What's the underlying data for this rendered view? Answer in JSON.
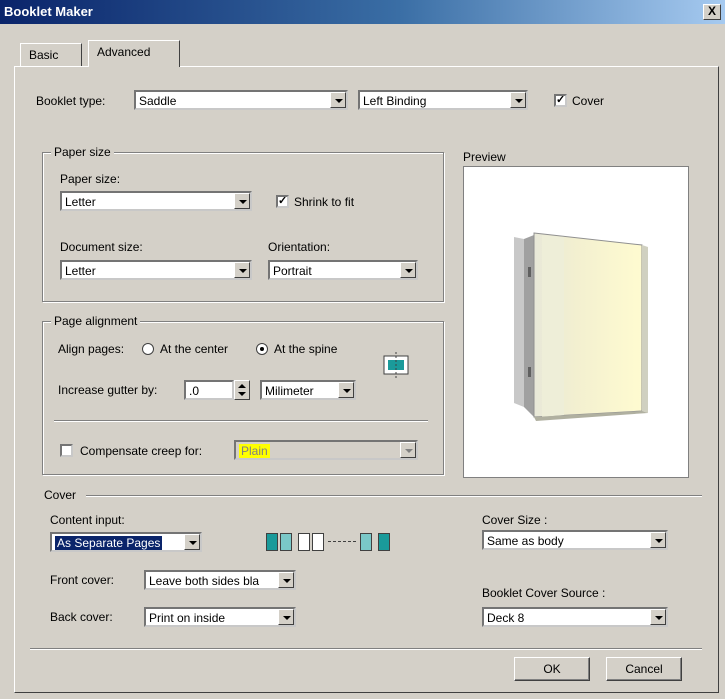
{
  "window": {
    "title": "Booklet Maker",
    "close_glyph": "X"
  },
  "tabs": [
    {
      "label": "Basic"
    },
    {
      "label": "Advanced"
    }
  ],
  "booklet": {
    "type_label": "Booklet type:",
    "type_value": "Saddle",
    "binding_value": "Left Binding",
    "cover_label": "Cover",
    "cover_checked": true
  },
  "paper_size_group": {
    "legend": "Paper size",
    "paper_size_label": "Paper size:",
    "paper_size_value": "Letter",
    "shrink_label": "Shrink to fit",
    "shrink_checked": true,
    "document_size_label": "Document size:",
    "document_size_value": "Letter",
    "orientation_label": "Orientation:",
    "orientation_value": "Portrait"
  },
  "preview": {
    "label": "Preview"
  },
  "page_alignment_group": {
    "legend": "Page alignment",
    "align_label": "Align pages:",
    "at_center_label": "At the center",
    "at_spine_label": "At the spine",
    "selected": "At the spine",
    "gutter_label": "Increase gutter by:",
    "gutter_value": ".0",
    "unit_value": "Milimeter",
    "creep_label": "Compensate creep for:",
    "creep_value": "Plain",
    "creep_checked": false
  },
  "cover_group": {
    "legend": "Cover",
    "content_input_label": "Content input:",
    "content_input_value": "As Separate Pages",
    "front_cover_label": "Front cover:",
    "front_cover_value": "Leave both sides bla",
    "back_cover_label": "Back cover:",
    "back_cover_value": "Print on inside",
    "cover_size_label": "Cover Size :",
    "cover_size_value": "Same as body",
    "cover_source_label": "Booklet Cover Source :",
    "cover_source_value": "Deck 8"
  },
  "buttons": {
    "ok": "OK",
    "cancel": "Cancel"
  },
  "colors": {
    "accent": "#0a246a",
    "preview_page": "#fffbd0",
    "icon_teal": "#1a9a9a"
  }
}
